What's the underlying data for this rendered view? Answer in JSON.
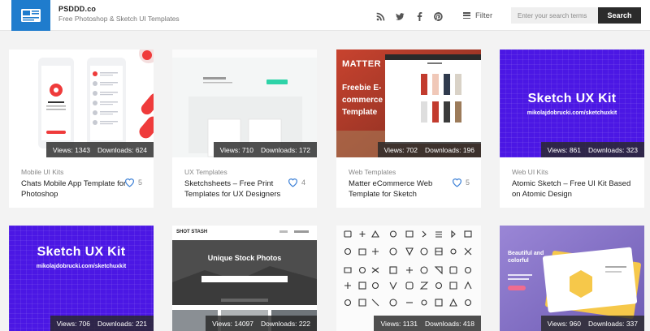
{
  "brand": {
    "name": "PSDDD.co",
    "tagline": "Free Photoshop & Sketch UI Templates"
  },
  "header": {
    "social_icons": [
      "rss-icon",
      "twitter-icon",
      "facebook-icon",
      "pinterest-icon"
    ],
    "filter_label": "Filter",
    "search_placeholder": "Enter your search terms",
    "search_button": "Search"
  },
  "colors": {
    "logo_blue": "#1f7ccd",
    "heart_blue": "#3a7fd6",
    "dark": "#2b2b2b"
  },
  "views_label": "Views:",
  "downloads_label": "Downloads:",
  "cards": [
    {
      "category": "Mobile UI Kits",
      "title": "Chats Mobile App Template for Photoshop",
      "views": "1343",
      "downloads": "624",
      "likes": "5"
    },
    {
      "category": "UX Templates",
      "title": "Sketchsheets – Free Print Templates for UX Designers",
      "views": "710",
      "downloads": "172",
      "likes": "4"
    },
    {
      "category": "Web Templates",
      "title": "Matter eCommerce Web Template for Sketch",
      "views": "702",
      "downloads": "196",
      "likes": "5"
    },
    {
      "category": "Web UI Kits",
      "title": "Atomic Sketch – Free UI Kit Based on Atomic Design",
      "views": "861",
      "downloads": "323",
      "likes": ""
    },
    {
      "category": "",
      "title": "",
      "views": "706",
      "downloads": "221",
      "likes": ""
    },
    {
      "category": "",
      "title": "",
      "views": "14097",
      "downloads": "222",
      "likes": ""
    },
    {
      "category": "",
      "title": "",
      "views": "1131",
      "downloads": "418",
      "likes": ""
    },
    {
      "category": "",
      "title": "",
      "views": "960",
      "downloads": "337",
      "likes": ""
    }
  ],
  "thumbs": {
    "matter_brand": "MATTER",
    "matter_headline": "Freebie E-commerce Template",
    "sketch_ux_title": "Sketch UX Kit",
    "sketch_ux_url": "mikolajdobrucki.com/sketchuxkit",
    "shot_stash_brand": "SHOT STASH",
    "shot_stash_title": "Unique Stock Photos",
    "beautiful_text": "Beautiful and colorful"
  }
}
